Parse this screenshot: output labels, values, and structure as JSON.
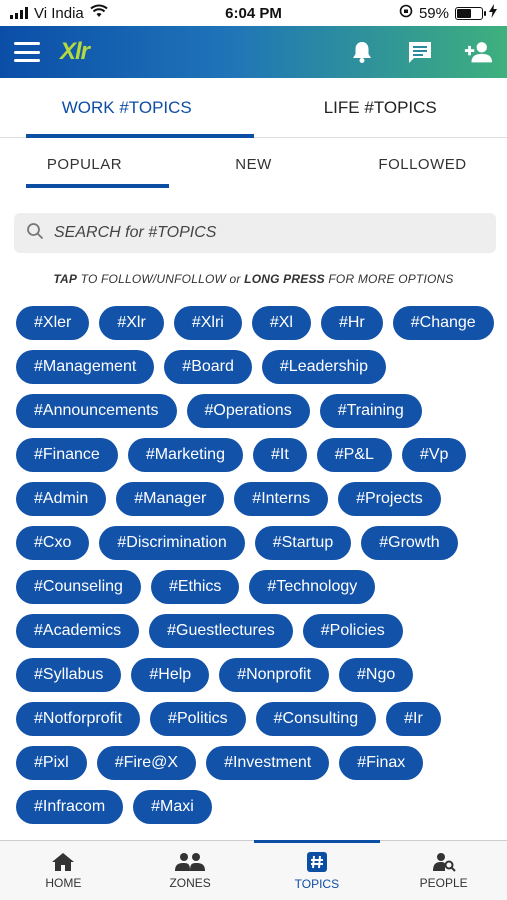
{
  "status_bar": {
    "carrier": "Vi India",
    "time": "6:04 PM",
    "battery": "59%",
    "battery_level": 0.59
  },
  "header": {
    "logo": "Xlr",
    "icons": [
      "bell-icon",
      "chat-icon",
      "add-user-icon"
    ]
  },
  "primary_tabs": [
    {
      "label": "WORK #TOPICS",
      "active": true
    },
    {
      "label": "LIFE #TOPICS",
      "active": false
    }
  ],
  "secondary_tabs": [
    {
      "label": "POPULAR",
      "active": true
    },
    {
      "label": "NEW",
      "active": false
    },
    {
      "label": "FOLLOWED",
      "active": false
    }
  ],
  "search": {
    "placeholder": "SEARCH for #TOPICS"
  },
  "hint": {
    "tap": "TAP",
    "mid": " TO FOLLOW/UNFOLLOW or ",
    "long_press": "LONG PRESS",
    "end": " FOR MORE OPTIONS"
  },
  "topics": [
    "#Xler",
    "#Xlr",
    "#Xlri",
    "#Xl",
    "#Hr",
    "#Change",
    "#Management",
    "#Board",
    "#Leadership",
    "#Announcements",
    "#Operations",
    "#Training",
    "#Finance",
    "#Marketing",
    "#It",
    "#P&L",
    "#Vp",
    "#Admin",
    "#Manager",
    "#Interns",
    "#Projects",
    "#Cxo",
    "#Discrimination",
    "#Startup",
    "#Growth",
    "#Counseling",
    "#Ethics",
    "#Technology",
    "#Academics",
    "#Guestlectures",
    "#Policies",
    "#Syllabus",
    "#Help",
    "#Nonprofit",
    "#Ngo",
    "#Notforprofit",
    "#Politics",
    "#Consulting",
    "#Ir",
    "#Pixl",
    "#Fire@X",
    "#Investment",
    "#Finax",
    "#Infracom",
    "#Maxi"
  ],
  "bottom_nav": [
    {
      "label": "HOME",
      "icon": "home-icon",
      "active": false
    },
    {
      "label": "ZONES",
      "icon": "group-icon",
      "active": false
    },
    {
      "label": "TOPICS",
      "icon": "hashtag-icon",
      "active": true
    },
    {
      "label": "PEOPLE",
      "icon": "people-search-icon",
      "active": false
    }
  ],
  "colors": {
    "brand_blue": "#0d4ea5",
    "chip_blue": "#1252a8",
    "header_green": "#3fb07d",
    "logo_green": "#b6d93c"
  }
}
